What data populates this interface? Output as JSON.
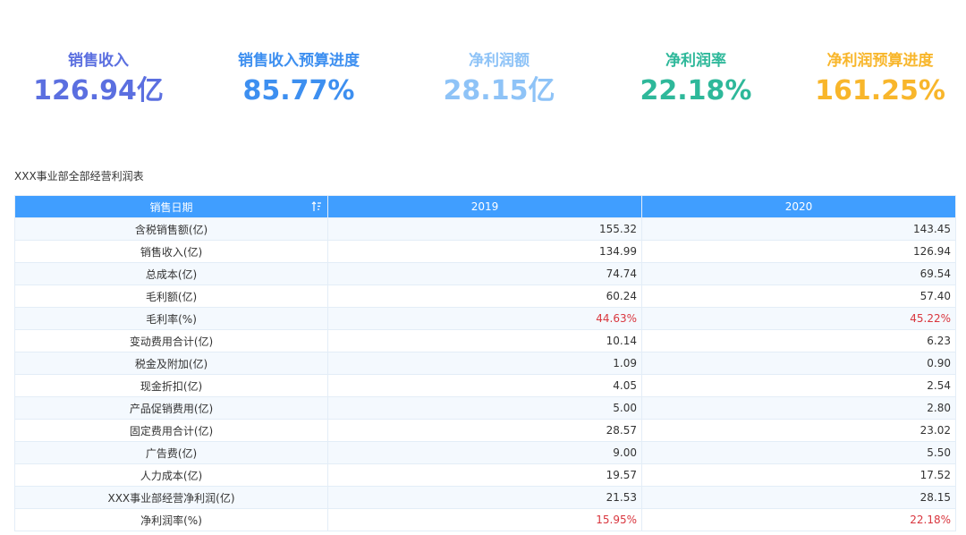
{
  "kpis": [
    {
      "label": "销售收入",
      "value": "126.94亿",
      "color": "#5b6fe0"
    },
    {
      "label": "销售收入预算进度",
      "value": "85.77%",
      "color": "#3d8ff0"
    },
    {
      "label": "净利润额",
      "value": "28.15亿",
      "color": "#8ec3f7"
    },
    {
      "label": "净利润率",
      "value": "22.18%",
      "color": "#2eb89a"
    },
    {
      "label": "净利润预算进度",
      "value": "161.25%",
      "color": "#f8b62b"
    }
  ],
  "table": {
    "title": "XXX事业部全部经营利润表",
    "header": {
      "col0": "销售日期",
      "col1": "2019",
      "col2": "2020"
    },
    "sort_icon": "sort-icon",
    "highlight_color": "#d9363e",
    "rows": [
      {
        "metric": "含税销售额(亿)",
        "v2019": "155.32",
        "v2020": "143.45",
        "highlight": false
      },
      {
        "metric": "销售收入(亿)",
        "v2019": "134.99",
        "v2020": "126.94",
        "highlight": false
      },
      {
        "metric": "总成本(亿)",
        "v2019": "74.74",
        "v2020": "69.54",
        "highlight": false
      },
      {
        "metric": "毛利额(亿)",
        "v2019": "60.24",
        "v2020": "57.40",
        "highlight": false
      },
      {
        "metric": "毛利率(%)",
        "v2019": "44.63%",
        "v2020": "45.22%",
        "highlight": true
      },
      {
        "metric": "变动费用合计(亿)",
        "v2019": "10.14",
        "v2020": "6.23",
        "highlight": false
      },
      {
        "metric": "税金及附加(亿)",
        "v2019": "1.09",
        "v2020": "0.90",
        "highlight": false
      },
      {
        "metric": "现金折扣(亿)",
        "v2019": "4.05",
        "v2020": "2.54",
        "highlight": false
      },
      {
        "metric": "产品促销费用(亿)",
        "v2019": "5.00",
        "v2020": "2.80",
        "highlight": false
      },
      {
        "metric": "固定费用合计(亿)",
        "v2019": "28.57",
        "v2020": "23.02",
        "highlight": false
      },
      {
        "metric": "广告费(亿)",
        "v2019": "9.00",
        "v2020": "5.50",
        "highlight": false
      },
      {
        "metric": "人力成本(亿)",
        "v2019": "19.57",
        "v2020": "17.52",
        "highlight": false
      },
      {
        "metric": "XXX事业部经营净利润(亿)",
        "v2019": "21.53",
        "v2020": "28.15",
        "highlight": false
      },
      {
        "metric": "净利润率(%)",
        "v2019": "15.95%",
        "v2020": "22.18%",
        "highlight": true
      }
    ]
  }
}
